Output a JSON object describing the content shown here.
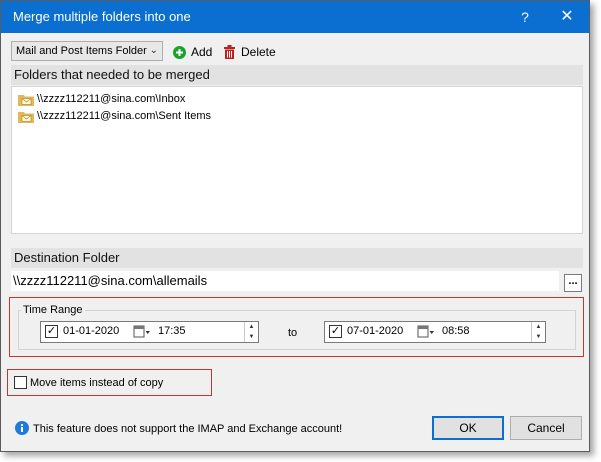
{
  "window": {
    "title": "Merge multiple folders into one",
    "help_label": "?",
    "close_label": "✕"
  },
  "toolbar": {
    "folder_type_value": "Mail and Post Items Folder",
    "add_label": "Add",
    "delete_label": "Delete"
  },
  "folders_section": {
    "heading": "Folders that needed to be merged",
    "items": [
      {
        "label": "\\\\zzzz112211@sina.com\\Inbox"
      },
      {
        "label": "\\\\zzzz112211@sina.com\\Sent Items"
      }
    ]
  },
  "destination": {
    "heading": "Destination Folder",
    "value": "\\\\zzzz112211@sina.com\\allemails",
    "browse_label": "..."
  },
  "time_range": {
    "title": "Time Range",
    "from": {
      "checked": true,
      "date": "01-01-2020",
      "time": "17:35"
    },
    "to_label": "to",
    "to": {
      "checked": true,
      "date": "07-01-2020",
      "time": "08:58"
    }
  },
  "move_items": {
    "label": "Move items instead of copy",
    "checked": false
  },
  "footer": {
    "info_text": "This feature does not support the IMAP and Exchange account!",
    "ok_label": "OK",
    "cancel_label": "Cancel"
  },
  "colors": {
    "titlebar": "#0a6fd1",
    "highlight_frame": "#c0392b",
    "add_icon": "#1aa32b",
    "delete_icon": "#c0201d",
    "info_icon": "#1e7bd8"
  },
  "icons": {
    "add": "plus-circle-icon",
    "delete": "trash-icon",
    "folder": "mail-folder-icon",
    "info": "info-icon",
    "calendar": "calendar-icon"
  }
}
